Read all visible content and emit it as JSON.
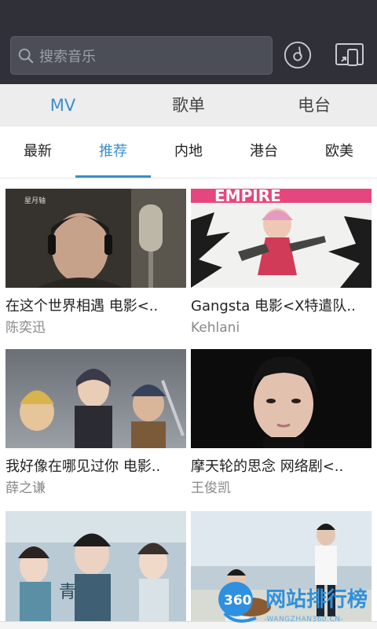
{
  "header": {
    "search_placeholder": "搜索音乐",
    "icons": [
      "search-icon",
      "music-disc-icon",
      "screen-cast-icon"
    ]
  },
  "category_tabs": [
    {
      "label": "MV",
      "active": true
    },
    {
      "label": "歌单",
      "active": false
    },
    {
      "label": "电台",
      "active": false
    }
  ],
  "sub_tabs": [
    {
      "label": "最新",
      "active": false
    },
    {
      "label": "推荐",
      "active": true
    },
    {
      "label": "内地",
      "active": false
    },
    {
      "label": "港台",
      "active": false
    },
    {
      "label": "欧美",
      "active": false
    }
  ],
  "videos": [
    {
      "title": "在这个世界相遇 电影<..",
      "artist": "陈奕迅",
      "thumb_text": "星月轴"
    },
    {
      "title": "Gangsta 电影<X特遣队..",
      "artist": "Kehlani",
      "thumb_text": "EMPIRE"
    },
    {
      "title": "我好像在哪见过你 电影..",
      "artist": "薛之谦",
      "thumb_text": ""
    },
    {
      "title": "摩天轮的思念 网络剧<..",
      "artist": "王俊凯",
      "thumb_text": ""
    },
    {
      "title": "",
      "artist": "",
      "thumb_text": ""
    },
    {
      "title": "",
      "artist": "",
      "thumb_text": ""
    }
  ],
  "watermark": {
    "badge": "360",
    "name": "网站排行榜",
    "sub": "-WANGZHAN360.CN-"
  },
  "colors": {
    "header_bg": "#2f3038",
    "accent": "#3a8fc7",
    "tab_bar_bg": "#ededed"
  }
}
